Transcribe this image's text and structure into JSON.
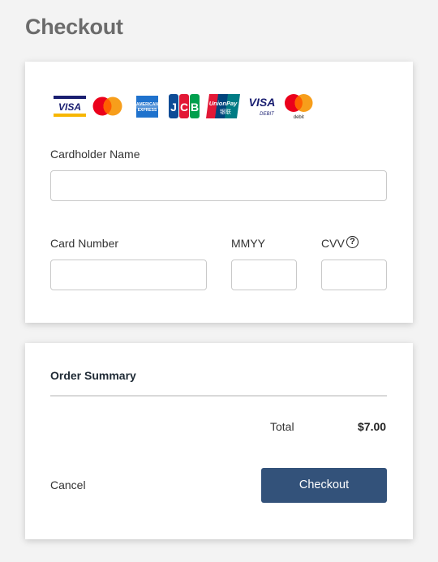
{
  "page": {
    "title": "Checkout"
  },
  "payment": {
    "card_logos": [
      {
        "name": "visa-logo",
        "text": "VISA"
      },
      {
        "name": "mastercard-logo",
        "text": ""
      },
      {
        "name": "amex-logo",
        "text": "AMERICAN EXPRESS"
      },
      {
        "name": "jcb-logo",
        "text": "JCB"
      },
      {
        "name": "unionpay-logo",
        "text": "UnionPay 银联"
      },
      {
        "name": "visa-debit-logo",
        "text": "VISA DEBIT"
      },
      {
        "name": "mastercard-debit-logo",
        "text": "debit"
      }
    ],
    "cardholder_label": "Cardholder Name",
    "cardholder_value": "",
    "card_number_label": "Card Number",
    "card_number_value": "",
    "expiry_label": "MMYY",
    "expiry_value": "",
    "cvv_label": "CVV",
    "cvv_value": "",
    "cvv_help": "?"
  },
  "summary": {
    "title": "Order Summary",
    "total_label": "Total",
    "total_value": "$7.00",
    "cancel_label": "Cancel",
    "checkout_label": "Checkout"
  },
  "colors": {
    "page_background": "#f3f3f3",
    "title_text": "#6b6b6b",
    "checkout_button": "#33527a"
  }
}
